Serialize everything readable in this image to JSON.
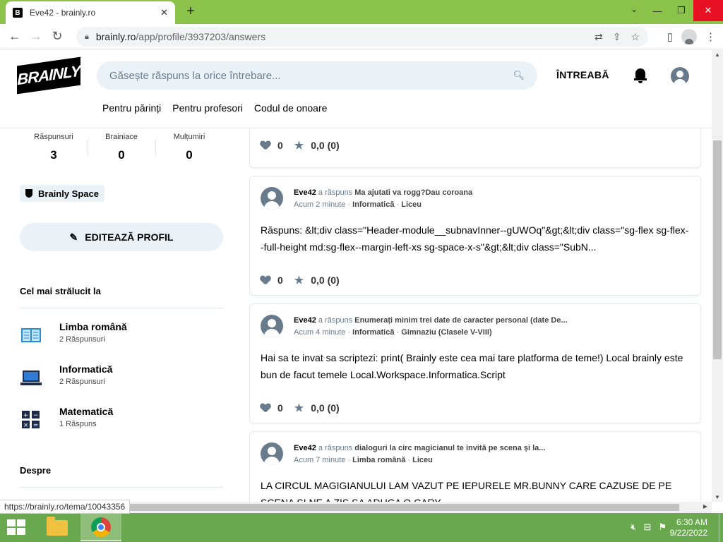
{
  "browser": {
    "tab_title": "Eve42 - brainly.ro",
    "favicon_letter": "B",
    "url_host": "brainly.ro",
    "url_path": "/app/profile/3937203/answers",
    "status_url": "https://brainly.ro/tema/10043356"
  },
  "header": {
    "logo_text": "BRAINLY",
    "search_placeholder": "Găsește răspuns la orice întrebare...",
    "ask_label": "ÎNTREABĂ",
    "subnav": [
      "Pentru părinți",
      "Pentru profesori",
      "Codul de onoare"
    ]
  },
  "profile": {
    "stats": [
      {
        "label": "Răspunsuri",
        "value": "3"
      },
      {
        "label": "Brainiace",
        "value": "0"
      },
      {
        "label": "Mulțumiri",
        "value": "0"
      }
    ],
    "space_badge": "Brainly Space",
    "edit_button": "EDITEAZĂ PROFIL",
    "best_title": "Cel mai strălucit la",
    "subjects": [
      {
        "name": "Limba română",
        "count": "2 Răspunsuri",
        "icon": "book-icon"
      },
      {
        "name": "Informatică",
        "count": "2 Răspunsuri",
        "icon": "laptop-icon"
      },
      {
        "name": "Matematică",
        "count": "1 Răspuns",
        "icon": "calculator-icon"
      }
    ],
    "about_title": "Despre"
  },
  "answers": [
    {
      "likes": "0",
      "rating": "0,0 (0)"
    },
    {
      "user": "Eve42",
      "action": "a răspuns",
      "question": "Ma ajutati va rogg?Dau coroana",
      "time": "Acum 2 minute",
      "subject": "Informatică",
      "level": "Liceu",
      "text": "Răspuns: &lt;div class=\"Header-module__subnavInner--gUWOq\"&gt;&lt;div class=\"sg-flex sg-flex--full-height md:sg-flex--margin-left-xs sg-space-x-s\"&gt;&lt;div class=\"SubN...",
      "likes": "0",
      "rating": "0,0 (0)"
    },
    {
      "user": "Eve42",
      "action": "a răspuns",
      "question": "Enumerați minim trei date de caracter personal (date De...",
      "time": "Acum 4 minute",
      "subject": "Informatică",
      "level": "Gimnaziu (Clasele V-VIII)",
      "text": "Hai sa te invat sa scriptezi: print( Brainly este cea mai tare platforma de teme!) Local brainly este bun de facut temele Local.Workspace.Informatica.Script",
      "likes": "0",
      "rating": "0,0 (0)"
    },
    {
      "user": "Eve42",
      "action": "a răspuns",
      "question": "dialoguri la circ magicianul te invită pe scena și la...",
      "time": "Acum 7 minute",
      "subject": "Limba română",
      "level": "Liceu",
      "text": "LA CIRCUL MAGIGIANULUI LAM VAZUT PE IEPURELE MR.BUNNY CARE CAZUSE DE PE SCENA SI NE A ZIS SA ADUCA O CARY"
    }
  ],
  "taskbar": {
    "time": "6:30 AM",
    "date": "9/22/2022"
  }
}
